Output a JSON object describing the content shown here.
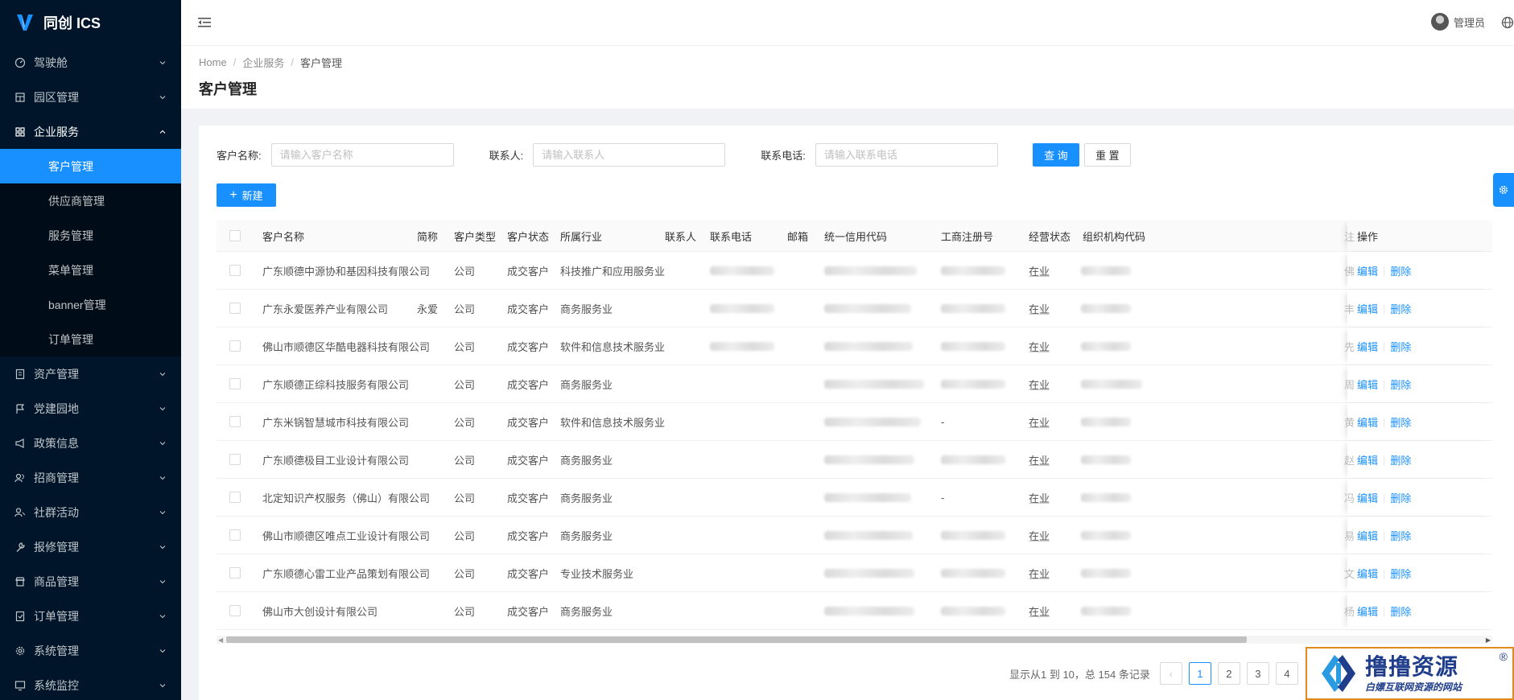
{
  "app": {
    "title": "同创 ICS"
  },
  "sidebar": {
    "items": [
      {
        "label": "驾驶舱",
        "icon": "dashboard-icon"
      },
      {
        "label": "园区管理",
        "icon": "building-icon"
      },
      {
        "label": "企业服务",
        "icon": "grid-icon",
        "open": true,
        "children": [
          {
            "label": "客户管理",
            "active": true
          },
          {
            "label": "供应商管理"
          },
          {
            "label": "服务管理"
          },
          {
            "label": "菜单管理"
          },
          {
            "label": "banner管理"
          },
          {
            "label": "订单管理"
          }
        ]
      },
      {
        "label": "资产管理",
        "icon": "asset-icon"
      },
      {
        "label": "党建园地",
        "icon": "flag-icon"
      },
      {
        "label": "政策信息",
        "icon": "megaphone-icon"
      },
      {
        "label": "招商管理",
        "icon": "users-icon"
      },
      {
        "label": "社群活动",
        "icon": "community-icon"
      },
      {
        "label": "报修管理",
        "icon": "wrench-icon"
      },
      {
        "label": "商品管理",
        "icon": "shop-icon"
      },
      {
        "label": "订单管理",
        "icon": "order-icon"
      },
      {
        "label": "系统管理",
        "icon": "gear-icon"
      },
      {
        "label": "系统监控",
        "icon": "monitor-icon"
      }
    ]
  },
  "header": {
    "user": "管理员"
  },
  "breadcrumb": [
    "Home",
    "企业服务",
    "客户管理"
  ],
  "page": {
    "title": "客户管理"
  },
  "search": {
    "name_label": "客户名称:",
    "name_placeholder": "请输入客户名称",
    "contact_label": "联系人:",
    "contact_placeholder": "请输入联系人",
    "phone_label": "联系电话:",
    "phone_placeholder": "请输入联系电话",
    "query_label": "查 询",
    "reset_label": "重 置"
  },
  "toolbar": {
    "new_label": "新建"
  },
  "table": {
    "columns": [
      "客户名称",
      "简称",
      "客户类型",
      "客户状态",
      "所属行业",
      "联系人",
      "联系电话",
      "邮箱",
      "统一信用代码",
      "工商注册号",
      "经营状态",
      "组织机构代码",
      "操作"
    ],
    "edit_label": "编辑",
    "delete_label": "删除",
    "rows": [
      {
        "name": "广东顺德中源协和基因科技有限公司",
        "short": "",
        "type": "公司",
        "status": "成交客户",
        "industry": "科技推广和应用服务业",
        "phone_blur": true,
        "reg": "blur",
        "state": "在业",
        "edge": "佛"
      },
      {
        "name": "广东永爱医养产业有限公司",
        "short": "永爱",
        "type": "公司",
        "status": "成交客户",
        "industry": "商务服务业",
        "phone_blur": true,
        "reg": "blur",
        "state": "在业",
        "edge": "丰"
      },
      {
        "name": "佛山市顺德区华酷电器科技有限公司",
        "short": "",
        "type": "公司",
        "status": "成交客户",
        "industry": "软件和信息技术服务业",
        "phone_blur": true,
        "reg": "blur",
        "state": "在业",
        "edge": "先"
      },
      {
        "name": "广东顺德正综科技服务有限公司",
        "short": "",
        "type": "公司",
        "status": "成交客户",
        "industry": "商务服务业",
        "phone_blur": false,
        "reg": "blur",
        "state": "在业",
        "edge": "周"
      },
      {
        "name": "广东米锅智慧城市科技有限公司",
        "short": "",
        "type": "公司",
        "status": "成交客户",
        "industry": "软件和信息技术服务业",
        "phone_blur": false,
        "reg": "-",
        "state": "在业",
        "edge": "黄"
      },
      {
        "name": "广东顺德极目工业设计有限公司",
        "short": "",
        "type": "公司",
        "status": "成交客户",
        "industry": "商务服务业",
        "phone_blur": false,
        "reg": "blur",
        "state": "在业",
        "edge": "赵"
      },
      {
        "name": "北定知识产权服务（佛山）有限公司",
        "short": "",
        "type": "公司",
        "status": "成交客户",
        "industry": "商务服务业",
        "phone_blur": false,
        "reg": "-",
        "state": "在业",
        "edge": "冯"
      },
      {
        "name": "佛山市顺德区唯点工业设计有限公司",
        "short": "",
        "type": "公司",
        "status": "成交客户",
        "industry": "商务服务业",
        "phone_blur": false,
        "reg": "blur",
        "state": "在业",
        "edge": "易"
      },
      {
        "name": "广东顺德心雷工业产品策划有限公司",
        "short": "",
        "type": "公司",
        "status": "成交客户",
        "industry": "专业技术服务业",
        "phone_blur": false,
        "reg": "blur",
        "state": "在业",
        "edge": "文"
      },
      {
        "name": "佛山市大创设计有限公司",
        "short": "",
        "type": "公司",
        "status": "成交客户",
        "industry": "商务服务业",
        "phone_blur": false,
        "reg": "blur",
        "state": "在业",
        "edge": "杨"
      }
    ]
  },
  "pagination": {
    "summary": "显示从1 到 10，总 154 条记录",
    "pages": [
      "1",
      "2",
      "3",
      "4"
    ],
    "current": "1"
  },
  "watermark": {
    "title": "撸撸资源",
    "subtitle": "白嫖互联网资源的网站",
    "reg": "®"
  },
  "colors": {
    "primary": "#1890ff",
    "sidebar": "#001529",
    "submenu": "#000c17"
  }
}
